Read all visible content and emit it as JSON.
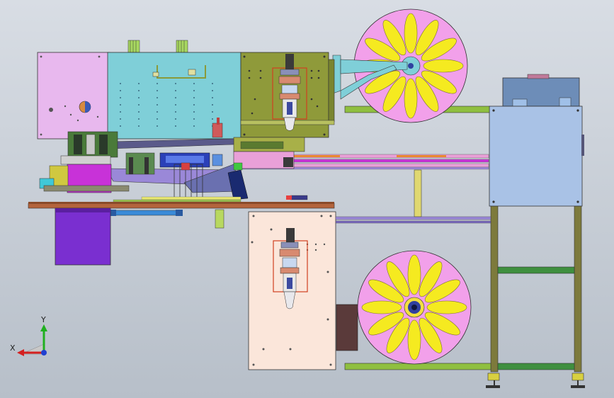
{
  "viewport": {
    "background_top": "#d8dde4",
    "background_bottom": "#b7bfc9"
  },
  "triad": {
    "x_label": "X",
    "y_label": "Y",
    "x_color": "#d42020",
    "y_color": "#20b020",
    "z_color": "#2040d0"
  },
  "colors": {
    "pink_panel": "#e8b8ee",
    "cyan_block": "#7fcfd8",
    "olive_block": "#8f9a3a",
    "peach_panel": "#fbe6da",
    "blue_box": "#a9c2e6",
    "reel_pink": "#f2a0ea",
    "reel_petal": "#f5ea20",
    "purple_box": "#7a2fd0",
    "table_brown": "#b4643c",
    "frame_olive": "#7d7a3c",
    "frame_green": "#3f8f3f",
    "rail_pink": "#e9a0d8",
    "rail_purple": "#9a88d8",
    "magenta": "#c832d8",
    "dark_brown": "#5a3a3a"
  },
  "components": [
    "upper-tape-reel",
    "lower-tape-reel",
    "left-housing-panel",
    "cyan-drive-block",
    "olive-mount-plate",
    "lower-mount-panel",
    "right-control-box",
    "support-frame",
    "purple-base-box",
    "work-table",
    "feed-rails"
  ]
}
